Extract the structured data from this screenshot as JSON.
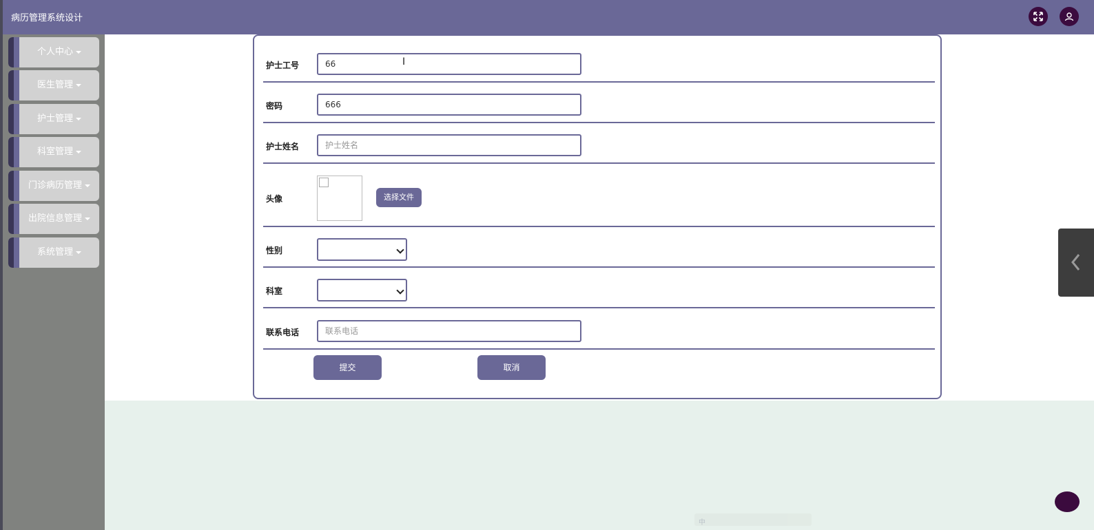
{
  "app": {
    "title": "病历管理系统设计"
  },
  "sidebar": {
    "items": [
      {
        "label": "个人中心"
      },
      {
        "label": "医生管理"
      },
      {
        "label": "护士管理"
      },
      {
        "label": "科室管理"
      },
      {
        "label": "门诊病历管理"
      },
      {
        "label": "出院信息管理"
      },
      {
        "label": "系统管理"
      }
    ]
  },
  "form": {
    "nurse_id": {
      "label": "护士工号",
      "value": "66"
    },
    "password": {
      "label": "密码",
      "value": "666"
    },
    "nurse_name": {
      "label": "护士姓名",
      "placeholder": "护士姓名",
      "value": ""
    },
    "avatar": {
      "label": "头像",
      "button": "选择文件"
    },
    "gender": {
      "label": "性别",
      "selected": ""
    },
    "department": {
      "label": "科室",
      "selected": ""
    },
    "phone": {
      "label": "联系电话",
      "placeholder": "联系电话",
      "value": ""
    },
    "submit": "提交",
    "cancel": "取消"
  },
  "ime": {
    "glyph": "中"
  },
  "colors": {
    "primary": "#6a6897",
    "sidebar": "#80827f",
    "dark_accent": "#3b0b3e",
    "background": "#e7f1ec"
  }
}
